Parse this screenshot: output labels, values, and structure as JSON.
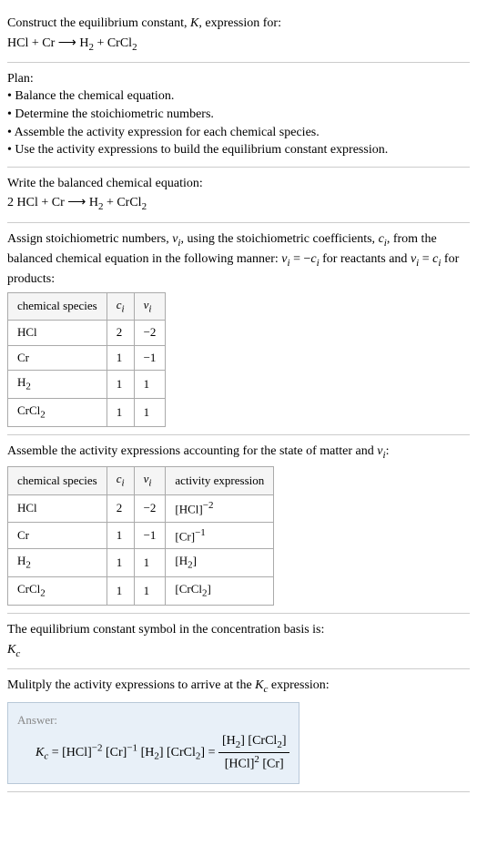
{
  "intro": {
    "line1": "Construct the equilibrium constant, ",
    "k": "K",
    "line1b": ", expression for:",
    "eq_lhs": "HCl + Cr",
    "arrow": "⟶",
    "eq_rhs_h2": "H",
    "eq_rhs_h2sub": "2",
    "eq_rhs_plus": " + CrCl",
    "eq_rhs_crcl2sub": "2"
  },
  "plan": {
    "header": "Plan:",
    "b1": "• Balance the chemical equation.",
    "b2": "• Determine the stoichiometric numbers.",
    "b3": "• Assemble the activity expression for each chemical species.",
    "b4": "• Use the activity expressions to build the equilibrium constant expression."
  },
  "balanced": {
    "header": "Write the balanced chemical equation:",
    "eq_lhs": "2 HCl + Cr",
    "arrow": "⟶",
    "eq_h2": "H",
    "eq_h2sub": "2",
    "eq_plus": " + CrCl",
    "eq_crcl2sub": "2"
  },
  "stoich": {
    "line1a": "Assign stoichiometric numbers, ",
    "nu": "ν",
    "isub": "i",
    "line1b": ", using the stoichiometric coefficients, ",
    "c": "c",
    "line1c": ", from the balanced chemical equation in the following manner: ",
    "eq1a": "ν",
    "eq1b": " = −",
    "eq1c": "c",
    "line1d": " for reactants and ",
    "eq2a": "ν",
    "eq2b": " = ",
    "eq2c": "c",
    "line1e": " for products:",
    "th1": "chemical species",
    "th2": "c",
    "th3": "ν",
    "rows": [
      {
        "species": "HCl",
        "c": "2",
        "nu": "−2"
      },
      {
        "species": "Cr",
        "c": "1",
        "nu": "−1"
      },
      {
        "species_a": "H",
        "species_sub": "2",
        "c": "1",
        "nu": "1"
      },
      {
        "species_a": "CrCl",
        "species_sub": "2",
        "c": "1",
        "nu": "1"
      }
    ]
  },
  "activity": {
    "line1": "Assemble the activity expressions accounting for the state of matter and ",
    "nu": "ν",
    "isub": "i",
    "colon": ":",
    "th1": "chemical species",
    "th2": "c",
    "th3": "ν",
    "th4": "activity expression",
    "rows": [
      {
        "species": "HCl",
        "c": "2",
        "nu": "−2",
        "act_a": "[HCl]",
        "act_sup": "−2"
      },
      {
        "species": "Cr",
        "c": "1",
        "nu": "−1",
        "act_a": "[Cr]",
        "act_sup": "−1"
      },
      {
        "species_a": "H",
        "species_sub": "2",
        "c": "1",
        "nu": "1",
        "act_a": "[H",
        "act_sub": "2",
        "act_b": "]"
      },
      {
        "species_a": "CrCl",
        "species_sub": "2",
        "c": "1",
        "nu": "1",
        "act_a": "[CrCl",
        "act_sub": "2",
        "act_b": "]"
      }
    ]
  },
  "symbol": {
    "line1": "The equilibrium constant symbol in the concentration basis is:",
    "k": "K",
    "ksub": "c"
  },
  "multiply": {
    "line1": "Mulitply the activity expressions to arrive at the ",
    "k": "K",
    "ksub": "c",
    "line1b": " expression:"
  },
  "answer": {
    "label": "Answer:",
    "k": "K",
    "ksub": "c",
    "eq": " = [HCl]",
    "sup1": "−2",
    "t2": " [Cr]",
    "sup2": "−1",
    "t3": " [H",
    "sub3": "2",
    "t4": "] [CrCl",
    "sub4": "2",
    "t5": "] = ",
    "num_a": "[H",
    "num_sub1": "2",
    "num_b": "] [CrCl",
    "num_sub2": "2",
    "num_c": "]",
    "den_a": "[HCl]",
    "den_sup": "2",
    "den_b": " [Cr]"
  },
  "chart_data": {
    "type": "table",
    "tables": [
      {
        "title": "Stoichiometric numbers",
        "columns": [
          "chemical species",
          "c_i",
          "ν_i"
        ],
        "rows": [
          [
            "HCl",
            2,
            -2
          ],
          [
            "Cr",
            1,
            -1
          ],
          [
            "H2",
            1,
            1
          ],
          [
            "CrCl2",
            1,
            1
          ]
        ]
      },
      {
        "title": "Activity expressions",
        "columns": [
          "chemical species",
          "c_i",
          "ν_i",
          "activity expression"
        ],
        "rows": [
          [
            "HCl",
            2,
            -2,
            "[HCl]^-2"
          ],
          [
            "Cr",
            1,
            -1,
            "[Cr]^-1"
          ],
          [
            "H2",
            1,
            1,
            "[H2]"
          ],
          [
            "CrCl2",
            1,
            1,
            "[CrCl2]"
          ]
        ]
      }
    ]
  }
}
